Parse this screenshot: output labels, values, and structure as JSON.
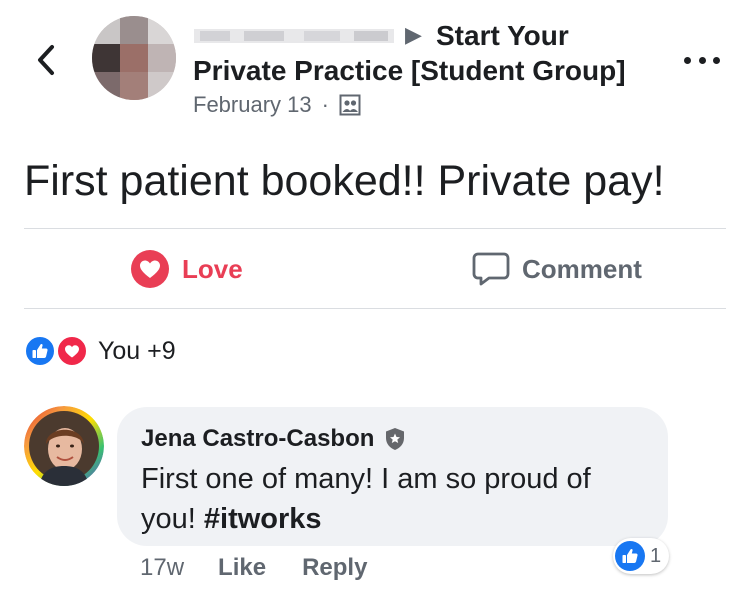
{
  "header": {
    "arrow": "▶",
    "group_line1": "Start Your",
    "group_line2": "Private Practice [Student Group]",
    "date": "February 13",
    "dot": "·"
  },
  "post": {
    "text": "First patient booked!! Private pay!"
  },
  "actions": {
    "love_label": "Love",
    "comment_label": "Comment"
  },
  "reactions": {
    "count_text": "You +9"
  },
  "comment": {
    "author": "Jena Castro-Casbon",
    "text": "First one of many! I am so proud of you!",
    "hashtag": "#itworks",
    "time": "17w",
    "like_label": "Like",
    "reply_label": "Reply",
    "reaction_count": "1"
  },
  "colors": {
    "love": "#e93e55",
    "like_blue": "#1877f2",
    "secondary_text": "#606770",
    "bubble_bg": "#f0f2f5"
  }
}
